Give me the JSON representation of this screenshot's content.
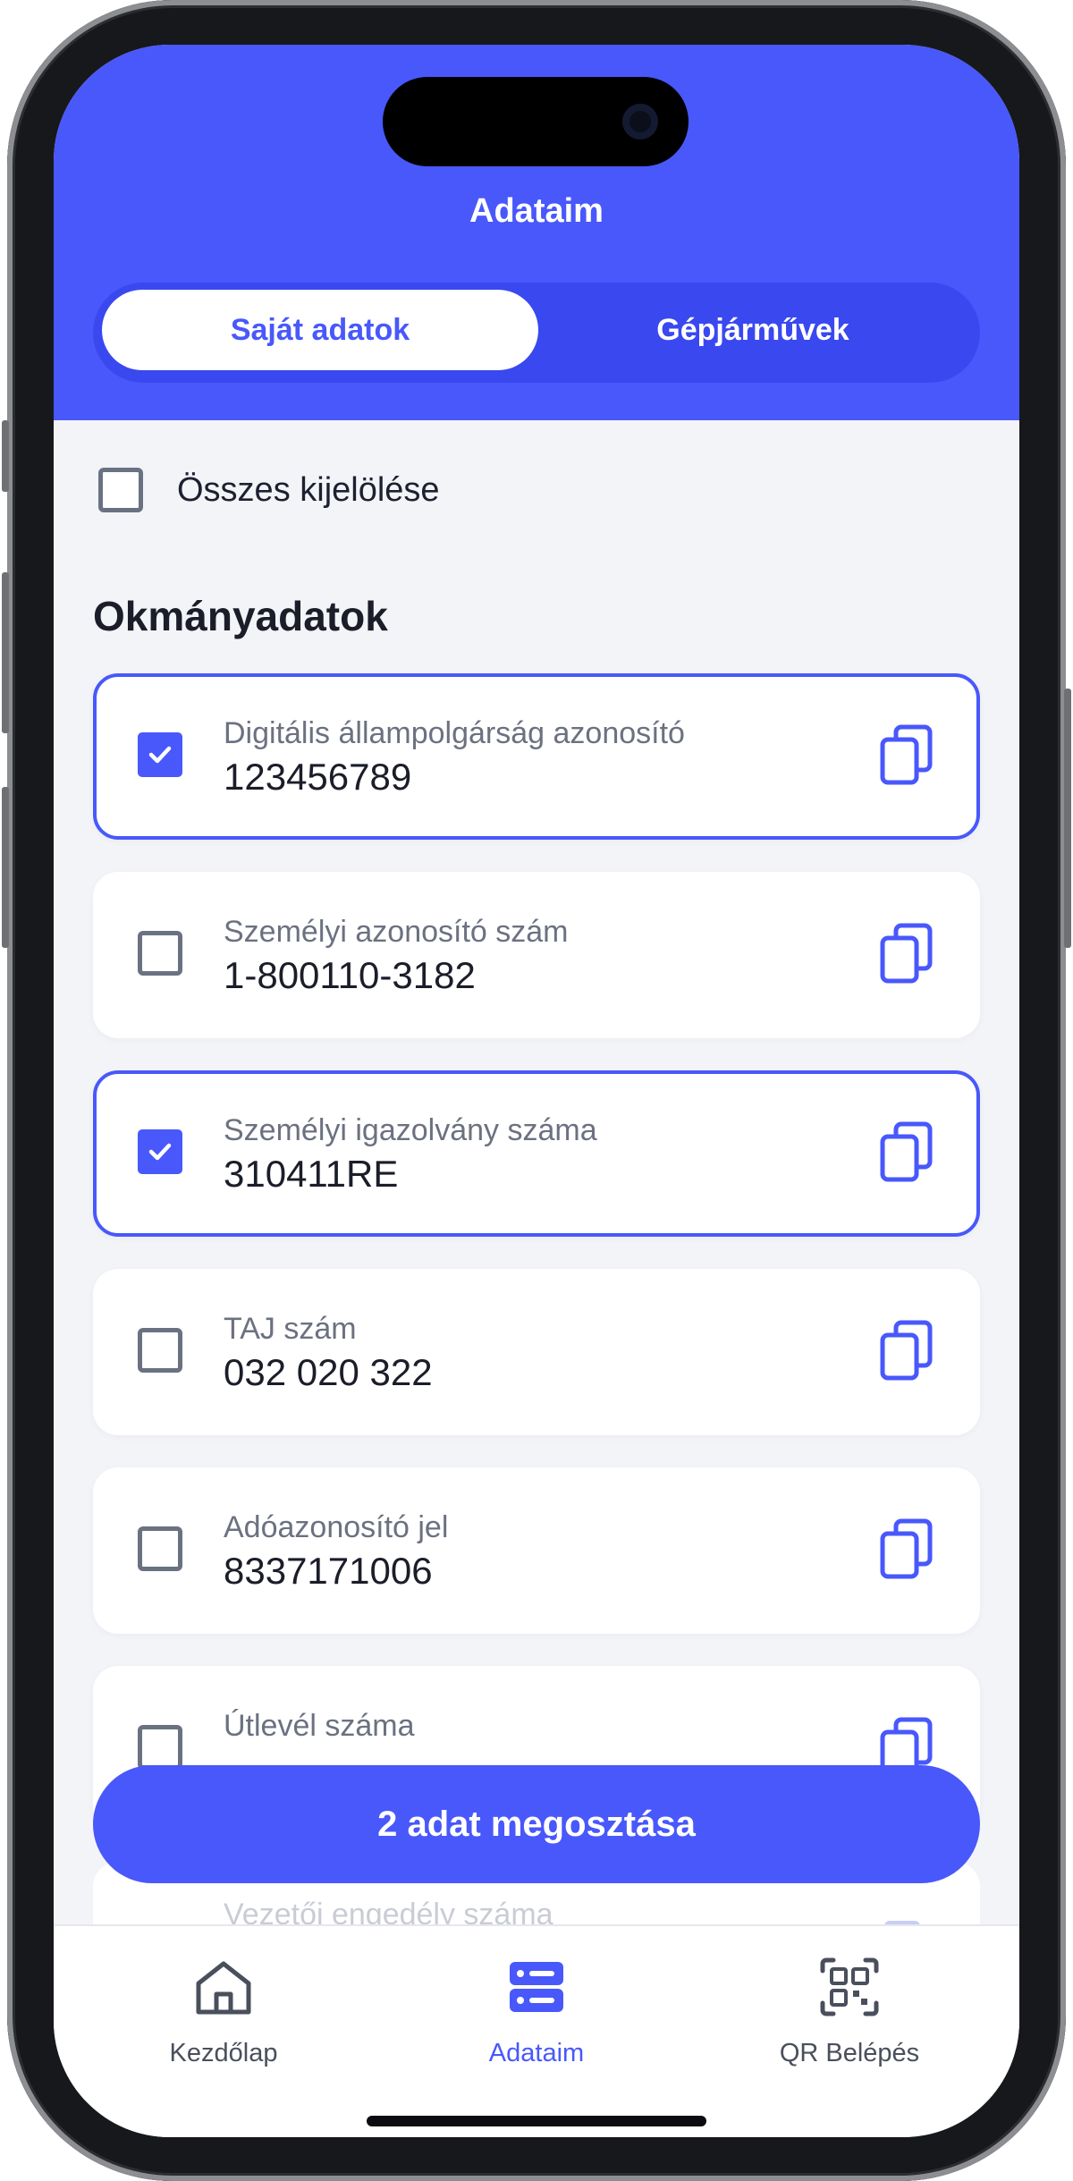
{
  "colors": {
    "accent": "#4858fb",
    "background": "#f3f4f8",
    "text_primary": "#1b1d29",
    "text_secondary": "#6b7180"
  },
  "header": {
    "title": "Adataim",
    "tabs": [
      {
        "label": "Saját adatok",
        "active": true
      },
      {
        "label": "Gépjárművek",
        "active": false
      }
    ]
  },
  "select_all": {
    "label": "Összes kijelölése",
    "checked": false
  },
  "section": {
    "title": "Okmányadatok"
  },
  "documents": [
    {
      "label": "Digitális állampolgárság azonosító",
      "value": "123456789",
      "checked": true,
      "icon": "copy-icon"
    },
    {
      "label": "Személyi azonosító szám",
      "value": "1-800110-3182",
      "checked": false,
      "icon": "copy-icon"
    },
    {
      "label": "Személyi igazolvány száma",
      "value": "310411RE",
      "checked": true,
      "icon": "copy-icon"
    },
    {
      "label": "TAJ szám",
      "value": "032 020 322",
      "checked": false,
      "icon": "copy-icon"
    },
    {
      "label": "Adóazonosító jel",
      "value": "8337171006",
      "checked": false,
      "icon": "copy-icon"
    },
    {
      "label": "Útlevél száma",
      "value": "",
      "checked": false,
      "icon": "copy-icon"
    },
    {
      "label": "Vezetői engedély száma",
      "value": "",
      "checked": false,
      "icon": "copy-icon"
    }
  ],
  "share_button": {
    "label": "2 adat megosztása"
  },
  "tabbar": {
    "items": [
      {
        "label": "Kezdőlap",
        "icon": "home-icon",
        "active": false
      },
      {
        "label": "Adataim",
        "icon": "list-icon",
        "active": true
      },
      {
        "label": "QR Belépés",
        "icon": "qr-code-icon",
        "active": false
      }
    ]
  }
}
